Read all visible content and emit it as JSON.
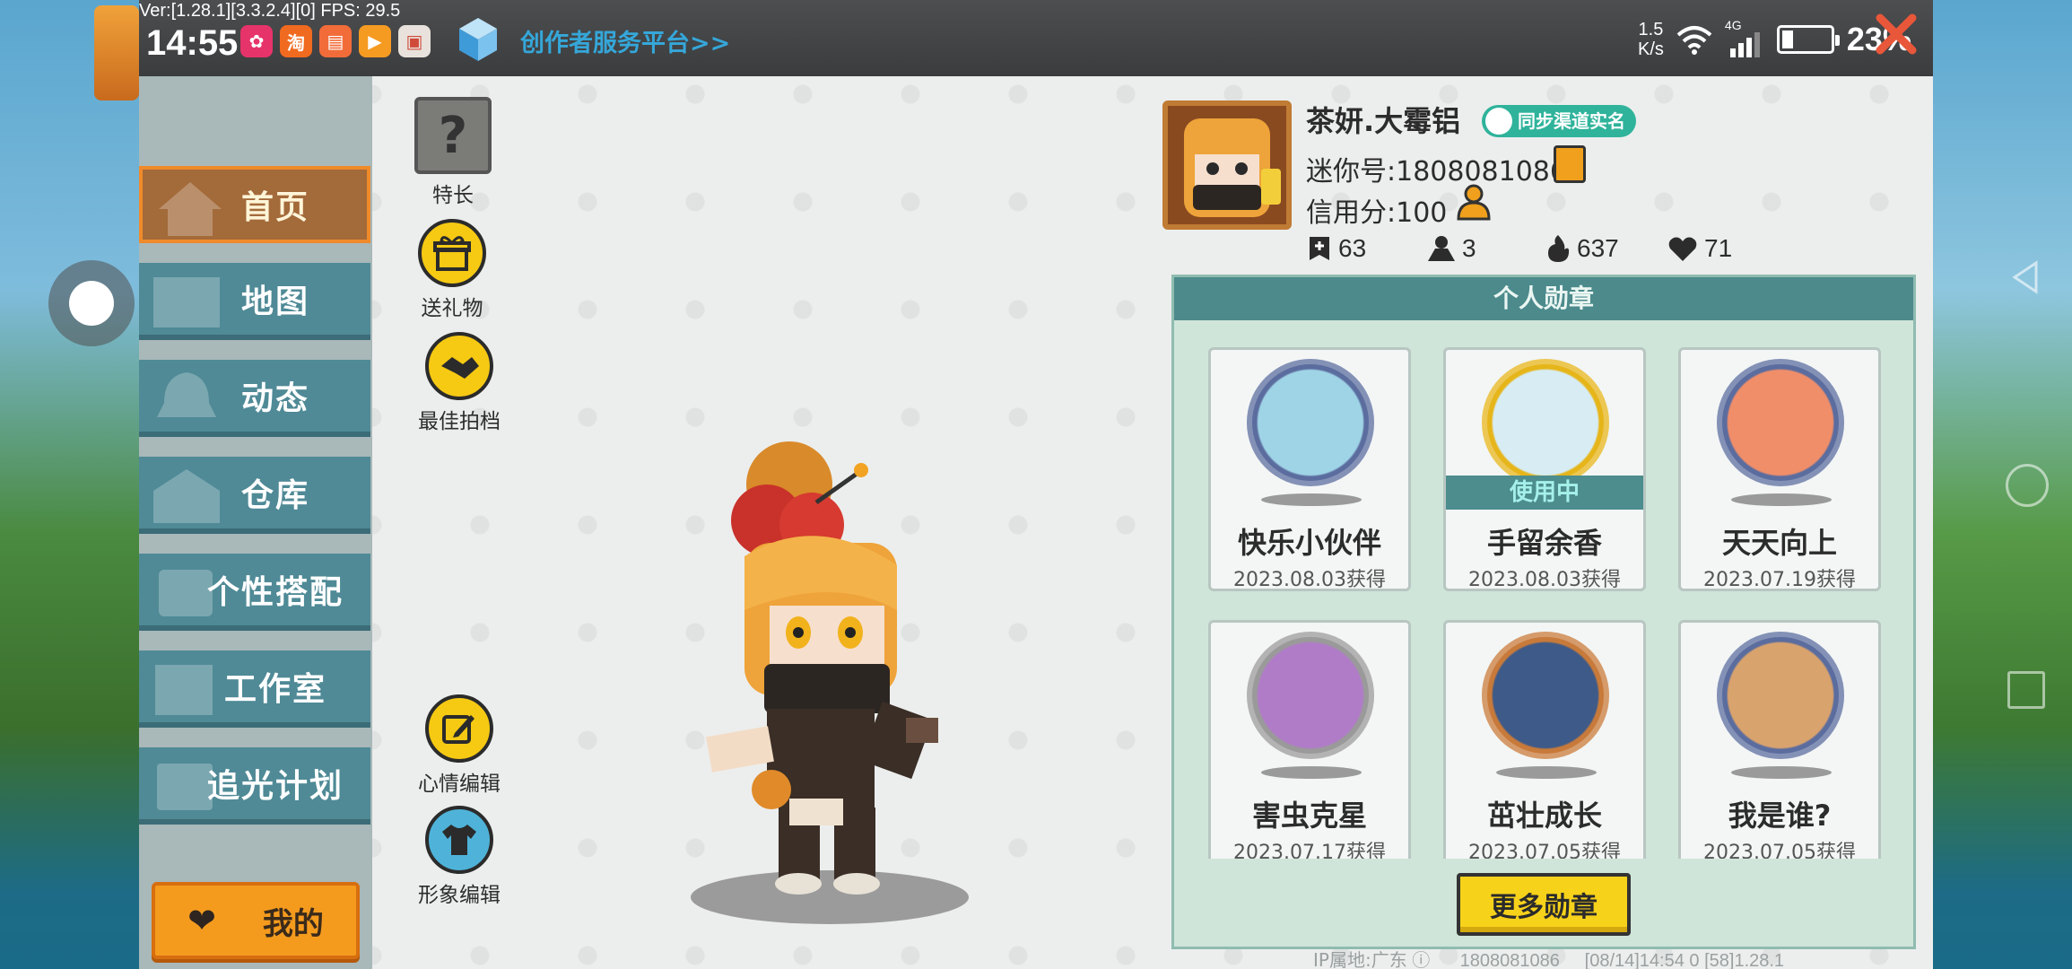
{
  "status_bar": {
    "debug": "Ver:[1.28.1][3.3.2.4][0] FPS: 29.5",
    "time": "14:55",
    "creator_link": "创作者服务平台>>",
    "net_speed_value": "1.5",
    "net_speed_unit": "K/s",
    "network": "4G",
    "battery_percent": "23%",
    "battery_level": 0.23,
    "notification_apps": [
      "app-red-icon",
      "app-taobao-icon",
      "app-book-icon",
      "app-video-icon",
      "app-gift-icon"
    ]
  },
  "sidebar": {
    "items": [
      {
        "label": "首页",
        "icon": "house-icon",
        "active": true
      },
      {
        "label": "地图",
        "icon": "map-icon"
      },
      {
        "label": "动态",
        "icon": "bell-icon"
      },
      {
        "label": "仓库",
        "icon": "warehouse-icon"
      },
      {
        "label": "个性搭配",
        "icon": "outfit-icon"
      },
      {
        "label": "工作室",
        "icon": "studio-icon"
      },
      {
        "label": "追光计划",
        "icon": "plan-icon"
      }
    ],
    "mine_label": "我的"
  },
  "icon_column": {
    "specialty": "特长",
    "send_gift": "送礼物",
    "best_partner": "最佳拍档",
    "mood_edit": "心情编辑",
    "avatar_edit": "形象编辑"
  },
  "profile": {
    "name": "茶妍.大霉铝",
    "sync_badge": "同步渠道实名",
    "mini_id": "迷你号:1808081086",
    "credit": "信用分:100",
    "stats": {
      "posts": "63",
      "followers": "3",
      "popularity": "637",
      "likes": "71"
    }
  },
  "medals": {
    "title": "个人勋章",
    "in_use_label": "使用中",
    "more_button": "更多勋章",
    "items": [
      {
        "name": "快乐小伙伴",
        "date": "2023.08.03获得",
        "in_use": false,
        "rim": "#5b6c9e",
        "inner": "#9fd4e6"
      },
      {
        "name": "手留余香",
        "date": "2023.08.03获得",
        "in_use": true,
        "rim": "#e6b51a",
        "inner": "#d7ecf3"
      },
      {
        "name": "天天向上",
        "date": "2023.07.19获得",
        "in_use": false,
        "rim": "#5b6c9e",
        "inner": "#f08e6a"
      },
      {
        "name": "害虫克星",
        "date": "2023.07.17获得",
        "in_use": false,
        "rim": "#9a9a9a",
        "inner": "#b07cc8"
      },
      {
        "name": "茁壮成长",
        "date": "2023.07.05获得",
        "in_use": false,
        "rim": "#c87a3a",
        "inner": "#3e5a88"
      },
      {
        "name": "我是谁?",
        "date": "2023.07.05获得",
        "in_use": false,
        "rim": "#5b6c9e",
        "inner": "#d9a36e"
      }
    ]
  },
  "footer": {
    "ip_location": "IP属地:广东",
    "id": "1808081086",
    "log": "[08/14]14:54 0  [58]1.28.1"
  },
  "colors": {
    "sidebar_item": "#4f8a96",
    "sidebar_active": "#a36a3a",
    "accent_orange": "#f49b1e",
    "medal_header": "#4c8a8c",
    "creator_link": "#35a7d9"
  }
}
